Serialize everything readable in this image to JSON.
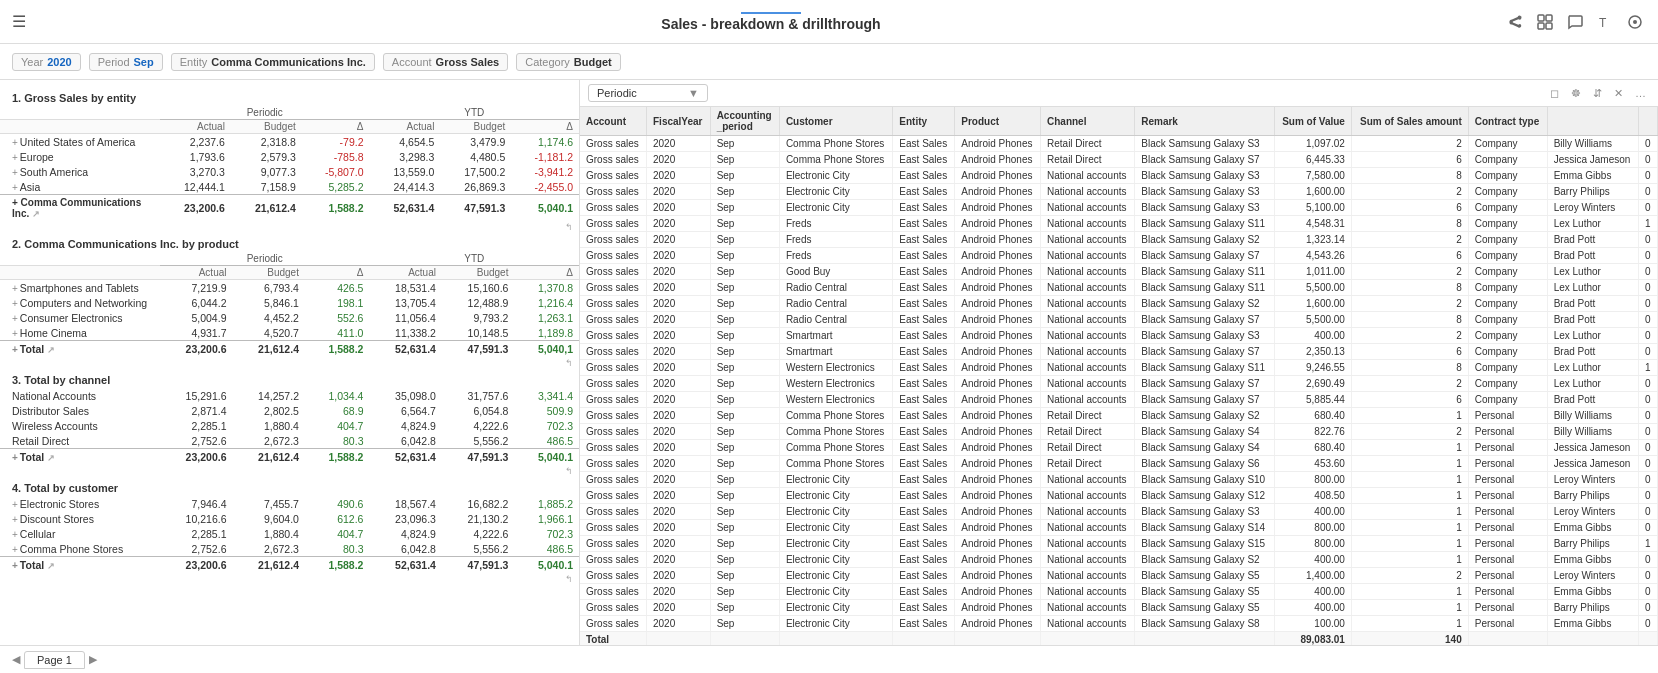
{
  "topbar": {
    "title": "Sales - breakdown & drillthrough"
  },
  "filters": [
    {
      "label": "Year",
      "value": "2020"
    },
    {
      "label": "Period",
      "value": "Sep"
    },
    {
      "label": "Entity",
      "value": "Comma Communications Inc."
    },
    {
      "label": "Account",
      "value": "Gross Sales"
    },
    {
      "label": "Category",
      "value": "Budget"
    }
  ],
  "sections": [
    {
      "id": "s1",
      "title": "1. Gross Sales by entity",
      "headers_group": [
        "Periodic",
        "YTD"
      ],
      "headers": [
        "Actual",
        "Budget",
        "Δ",
        "Actual",
        "Budget",
        "Δ"
      ],
      "rows": [
        {
          "label": "+ United States of America",
          "vals": [
            "2,237.6",
            "2,318.8",
            "-79.2",
            "4,654.5",
            "3,479.9",
            "1,174.6"
          ],
          "delta_idx": [
            2,
            5
          ],
          "neg": [
            2
          ],
          "pos": [
            5
          ]
        },
        {
          "label": "+ Europe",
          "vals": [
            "1,793.6",
            "2,579.3",
            "-785.8",
            "3,298.3",
            "4,480.5",
            "-1,181.2"
          ],
          "delta_idx": [
            2,
            5
          ],
          "neg": [
            2,
            5
          ]
        },
        {
          "label": "+ South America",
          "vals": [
            "3,270.3",
            "9,077.3",
            "-5,807.0",
            "13,559.0",
            "17,500.2",
            "-3,941.2"
          ],
          "delta_idx": [
            2,
            5
          ],
          "neg": [
            2,
            5
          ]
        },
        {
          "label": "+ Asia",
          "vals": [
            "12,444.1",
            "7,158.9",
            "5,285.2",
            "24,414.3",
            "26,869.3",
            "-2,455.0"
          ],
          "delta_idx": [
            2,
            5
          ],
          "pos": [
            2
          ],
          "neg": [
            5
          ]
        },
        {
          "label": "+ Comma Communications Inc.",
          "vals": [
            "23,200.6",
            "21,612.4",
            "1,588.2",
            "52,631.4",
            "47,591.3",
            "5,040.1"
          ],
          "total": true,
          "delta_idx": [
            2,
            5
          ],
          "pos": [
            2,
            5
          ]
        }
      ]
    },
    {
      "id": "s2",
      "title": "2. Comma Communications Inc. by product",
      "headers_group": [
        "Periodic",
        "YTD"
      ],
      "headers": [
        "Actual",
        "Budget",
        "Δ",
        "Actual",
        "Budget",
        "Δ"
      ],
      "rows": [
        {
          "label": "+ Smartphones and Tablets",
          "vals": [
            "7,219.9",
            "6,793.4",
            "426.5",
            "18,531.4",
            "15,160.6",
            "1,370.8"
          ],
          "pos": [
            2,
            5
          ]
        },
        {
          "label": "+ Computers and Networking",
          "vals": [
            "6,044.2",
            "5,846.1",
            "198.1",
            "13,705.4",
            "12,488.9",
            "1,216.4"
          ],
          "pos": [
            2,
            5
          ]
        },
        {
          "label": "+ Consumer Electronics",
          "vals": [
            "5,004.9",
            "4,452.2",
            "552.6",
            "11,056.4",
            "9,793.2",
            "1,263.1"
          ],
          "pos": [
            2,
            5
          ]
        },
        {
          "label": "+ Home Cinema",
          "vals": [
            "4,931.7",
            "4,520.7",
            "411.0",
            "11,338.2",
            "10,148.5",
            "1,189.8"
          ],
          "pos": [
            2,
            5
          ]
        },
        {
          "label": "+ Total",
          "vals": [
            "23,200.6",
            "21,612.4",
            "1,588.2",
            "52,631.4",
            "47,591.3",
            "5,040.1"
          ],
          "total": true,
          "pos": [
            2,
            5
          ]
        }
      ]
    },
    {
      "id": "s3",
      "title": "3. Total by channel",
      "headers_group": [
        "Periodic",
        "YTD"
      ],
      "headers": [
        "Actual",
        "Budget",
        "Δ",
        "Actual",
        "Budget",
        "Δ"
      ],
      "rows": [
        {
          "label": "National Accounts",
          "vals": [
            "15,291.6",
            "14,257.2",
            "1,034.4",
            "35,098.0",
            "31,757.6",
            "3,341.4"
          ],
          "pos": [
            2,
            5
          ]
        },
        {
          "label": "Distributor Sales",
          "vals": [
            "2,871.4",
            "2,802.5",
            "68.9",
            "6,564.7",
            "6,054.8",
            "509.9"
          ],
          "pos": [
            2,
            5
          ]
        },
        {
          "label": "Wireless Accounts",
          "vals": [
            "2,285.1",
            "1,880.4",
            "404.7",
            "4,824.9",
            "4,222.6",
            "702.3"
          ],
          "pos": [
            2,
            5
          ]
        },
        {
          "label": "Retail Direct",
          "vals": [
            "2,752.6",
            "2,672.3",
            "80.3",
            "6,042.8",
            "5,556.2",
            "486.5"
          ],
          "pos": [
            2,
            5
          ]
        },
        {
          "label": "+ Total",
          "vals": [
            "23,200.6",
            "21,612.4",
            "1,588.2",
            "52,631.4",
            "47,591.3",
            "5,040.1"
          ],
          "total": true,
          "pos": [
            2,
            5
          ]
        }
      ]
    },
    {
      "id": "s4",
      "title": "4. Total by customer",
      "headers_group": [
        "Periodic",
        "YTD"
      ],
      "headers": [
        "Actual",
        "Budget",
        "Δ",
        "Actual",
        "Budget",
        "Δ"
      ],
      "rows": [
        {
          "label": "+ Electronic Stores",
          "vals": [
            "7,946.4",
            "7,455.7",
            "490.6",
            "18,567.4",
            "16,682.2",
            "1,885.2"
          ],
          "pos": [
            2,
            5
          ]
        },
        {
          "label": "+ Discount Stores",
          "vals": [
            "10,216.6",
            "9,604.0",
            "612.6",
            "23,096.3",
            "21,130.2",
            "1,966.1"
          ],
          "pos": [
            2,
            5
          ]
        },
        {
          "label": "+ Cellular",
          "vals": [
            "2,285.1",
            "1,880.4",
            "404.7",
            "4,824.9",
            "4,222.6",
            "702.3"
          ],
          "pos": [
            2,
            5
          ]
        },
        {
          "label": "+ Comma Phone Stores",
          "vals": [
            "2,752.6",
            "2,672.3",
            "80.3",
            "6,042.8",
            "5,556.2",
            "486.5"
          ],
          "pos": [
            2,
            5
          ]
        },
        {
          "label": "+ Total",
          "vals": [
            "23,200.6",
            "21,612.4",
            "1,588.2",
            "52,631.4",
            "47,591.3",
            "5,040.1"
          ],
          "total": true,
          "pos": [
            2,
            5
          ]
        }
      ]
    }
  ],
  "right_panel": {
    "dropdown": "Periodic",
    "columns": [
      "Account",
      "FiscalYear",
      "Accounting_period",
      "Customer",
      "Entity",
      "Product",
      "Channel",
      "Remark",
      "Sum of Value",
      "Sum of Sales amount",
      "Contract type",
      "",
      ""
    ],
    "rows": [
      [
        "Gross sales",
        "2020",
        "Sep",
        "Comma Phone Stores",
        "East Sales",
        "Android Phones",
        "Retail Direct",
        "Black Samsung Galaxy S3",
        "1,097.02",
        "2",
        "Company",
        "Billy Williams",
        "0"
      ],
      [
        "Gross sales",
        "2020",
        "Sep",
        "Comma Phone Stores",
        "East Sales",
        "Android Phones",
        "Retail Direct",
        "Black Samsung Galaxy S7",
        "6,445.33",
        "6",
        "Company",
        "Jessica Jameson",
        "0"
      ],
      [
        "Gross sales",
        "2020",
        "Sep",
        "Electronic City",
        "East Sales",
        "Android Phones",
        "National accounts",
        "Black Samsung Galaxy S3",
        "7,580.00",
        "8",
        "Company",
        "Emma Gibbs",
        "0"
      ],
      [
        "Gross sales",
        "2020",
        "Sep",
        "Electronic City",
        "East Sales",
        "Android Phones",
        "National accounts",
        "Black Samsung Galaxy S3",
        "1,600.00",
        "2",
        "Company",
        "Barry Philips",
        "0"
      ],
      [
        "Gross sales",
        "2020",
        "Sep",
        "Electronic City",
        "East Sales",
        "Android Phones",
        "National accounts",
        "Black Samsung Galaxy S3",
        "5,100.00",
        "6",
        "Company",
        "Leroy Winters",
        "0"
      ],
      [
        "Gross sales",
        "2020",
        "Sep",
        "Freds",
        "East Sales",
        "Android Phones",
        "National accounts",
        "Black Samsung Galaxy S11",
        "4,548.31",
        "8",
        "Company",
        "Lex Luthor",
        "1"
      ],
      [
        "Gross sales",
        "2020",
        "Sep",
        "Freds",
        "East Sales",
        "Android Phones",
        "National accounts",
        "Black Samsung Galaxy S2",
        "1,323.14",
        "2",
        "Company",
        "Brad Pott",
        "0"
      ],
      [
        "Gross sales",
        "2020",
        "Sep",
        "Freds",
        "East Sales",
        "Android Phones",
        "National accounts",
        "Black Samsung Galaxy S7",
        "4,543.26",
        "6",
        "Company",
        "Brad Pott",
        "0"
      ],
      [
        "Gross sales",
        "2020",
        "Sep",
        "Good Buy",
        "East Sales",
        "Android Phones",
        "National accounts",
        "Black Samsung Galaxy S11",
        "1,011.00",
        "2",
        "Company",
        "Lex Luthor",
        "0"
      ],
      [
        "Gross sales",
        "2020",
        "Sep",
        "Radio Central",
        "East Sales",
        "Android Phones",
        "National accounts",
        "Black Samsung Galaxy S11",
        "5,500.00",
        "8",
        "Company",
        "Lex Luthor",
        "0"
      ],
      [
        "Gross sales",
        "2020",
        "Sep",
        "Radio Central",
        "East Sales",
        "Android Phones",
        "National accounts",
        "Black Samsung Galaxy S2",
        "1,600.00",
        "2",
        "Company",
        "Brad Pott",
        "0"
      ],
      [
        "Gross sales",
        "2020",
        "Sep",
        "Radio Central",
        "East Sales",
        "Android Phones",
        "National accounts",
        "Black Samsung Galaxy S7",
        "5,500.00",
        "8",
        "Company",
        "Brad Pott",
        "0"
      ],
      [
        "Gross sales",
        "2020",
        "Sep",
        "Smartmart",
        "East Sales",
        "Android Phones",
        "National accounts",
        "Black Samsung Galaxy S3",
        "400.00",
        "2",
        "Company",
        "Lex Luthor",
        "0"
      ],
      [
        "Gross sales",
        "2020",
        "Sep",
        "Smartmart",
        "East Sales",
        "Android Phones",
        "National accounts",
        "Black Samsung Galaxy S7",
        "2,350.13",
        "6",
        "Company",
        "Brad Pott",
        "0"
      ],
      [
        "Gross sales",
        "2020",
        "Sep",
        "Western Electronics",
        "East Sales",
        "Android Phones",
        "National accounts",
        "Black Samsung Galaxy S11",
        "9,246.55",
        "8",
        "Company",
        "Lex Luthor",
        "1"
      ],
      [
        "Gross sales",
        "2020",
        "Sep",
        "Western Electronics",
        "East Sales",
        "Android Phones",
        "National accounts",
        "Black Samsung Galaxy S7",
        "2,690.49",
        "2",
        "Company",
        "Lex Luthor",
        "0"
      ],
      [
        "Gross sales",
        "2020",
        "Sep",
        "Western Electronics",
        "East Sales",
        "Android Phones",
        "National accounts",
        "Black Samsung Galaxy S7",
        "5,885.44",
        "6",
        "Company",
        "Brad Pott",
        "0"
      ],
      [
        "Gross sales",
        "2020",
        "Sep",
        "Comma Phone Stores",
        "East Sales",
        "Android Phones",
        "Retail Direct",
        "Black Samsung Galaxy S2",
        "680.40",
        "1",
        "Personal",
        "Billy Williams",
        "0"
      ],
      [
        "Gross sales",
        "2020",
        "Sep",
        "Comma Phone Stores",
        "East Sales",
        "Android Phones",
        "Retail Direct",
        "Black Samsung Galaxy S4",
        "822.76",
        "2",
        "Personal",
        "Billy Williams",
        "0"
      ],
      [
        "Gross sales",
        "2020",
        "Sep",
        "Comma Phone Stores",
        "East Sales",
        "Android Phones",
        "Retail Direct",
        "Black Samsung Galaxy S4",
        "680.40",
        "1",
        "Personal",
        "Jessica Jameson",
        "0"
      ],
      [
        "Gross sales",
        "2020",
        "Sep",
        "Comma Phone Stores",
        "East Sales",
        "Android Phones",
        "Retail Direct",
        "Black Samsung Galaxy S6",
        "453.60",
        "1",
        "Personal",
        "Jessica Jameson",
        "0"
      ],
      [
        "Gross sales",
        "2020",
        "Sep",
        "Electronic City",
        "East Sales",
        "Android Phones",
        "National accounts",
        "Black Samsung Galaxy S10",
        "800.00",
        "1",
        "Personal",
        "Leroy Winters",
        "0"
      ],
      [
        "Gross sales",
        "2020",
        "Sep",
        "Electronic City",
        "East Sales",
        "Android Phones",
        "National accounts",
        "Black Samsung Galaxy S12",
        "408.50",
        "1",
        "Personal",
        "Barry Philips",
        "0"
      ],
      [
        "Gross sales",
        "2020",
        "Sep",
        "Electronic City",
        "East Sales",
        "Android Phones",
        "National accounts",
        "Black Samsung Galaxy S3",
        "400.00",
        "1",
        "Personal",
        "Leroy Winters",
        "0"
      ],
      [
        "Gross sales",
        "2020",
        "Sep",
        "Electronic City",
        "East Sales",
        "Android Phones",
        "National accounts",
        "Black Samsung Galaxy S14",
        "800.00",
        "1",
        "Personal",
        "Emma Gibbs",
        "0"
      ],
      [
        "Gross sales",
        "2020",
        "Sep",
        "Electronic City",
        "East Sales",
        "Android Phones",
        "National accounts",
        "Black Samsung Galaxy S15",
        "800.00",
        "1",
        "Personal",
        "Barry Philips",
        "1"
      ],
      [
        "Gross sales",
        "2020",
        "Sep",
        "Electronic City",
        "East Sales",
        "Android Phones",
        "National accounts",
        "Black Samsung Galaxy S2",
        "400.00",
        "1",
        "Personal",
        "Emma Gibbs",
        "0"
      ],
      [
        "Gross sales",
        "2020",
        "Sep",
        "Electronic City",
        "East Sales",
        "Android Phones",
        "National accounts",
        "Black Samsung Galaxy S5",
        "1,400.00",
        "2",
        "Personal",
        "Leroy Winters",
        "0"
      ],
      [
        "Gross sales",
        "2020",
        "Sep",
        "Electronic City",
        "East Sales",
        "Android Phones",
        "National accounts",
        "Black Samsung Galaxy S5",
        "400.00",
        "1",
        "Personal",
        "Emma Gibbs",
        "0"
      ],
      [
        "Gross sales",
        "2020",
        "Sep",
        "Electronic City",
        "East Sales",
        "Android Phones",
        "National accounts",
        "Black Samsung Galaxy S5",
        "400.00",
        "1",
        "Personal",
        "Barry Philips",
        "0"
      ],
      [
        "Gross sales",
        "2020",
        "Sep",
        "Electronic City",
        "East Sales",
        "Android Phones",
        "National accounts",
        "Black Samsung Galaxy S8",
        "100.00",
        "1",
        "Personal",
        "Emma Gibbs",
        "0"
      ]
    ],
    "total_row": [
      "Total",
      "",
      "",
      "",
      "",
      "",
      "",
      "",
      "89,083.01",
      "140",
      "",
      "",
      ""
    ]
  },
  "bottom": {
    "page_label": "Page 1"
  }
}
